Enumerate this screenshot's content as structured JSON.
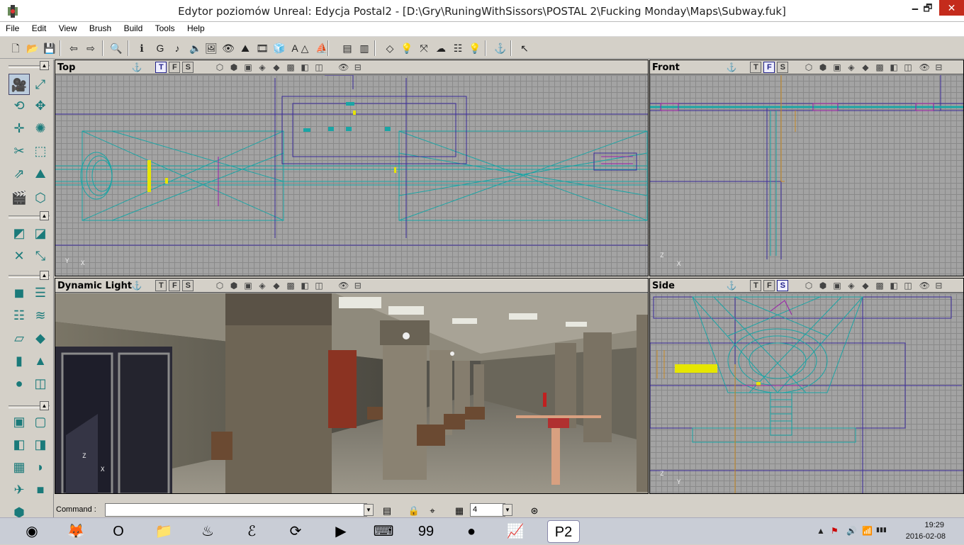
{
  "window": {
    "title": "Edytor poziomów Unreal: Edycja Postal2 - [D:\\Gry\\RuningWithSissors\\POSTAL 2\\Fucking Monday\\Maps\\Subway.fuk]",
    "minimize": "🗕",
    "maximize": "🗗",
    "close": "✕"
  },
  "menu": [
    "File",
    "Edit",
    "View",
    "Brush",
    "Build",
    "Tools",
    "Help"
  ],
  "toolbar_icons": [
    "new-file-icon",
    "open-folder-icon",
    "save-icon",
    "undo-icon",
    "redo-icon",
    "find-actor-icon",
    "actor-properties-icon",
    "group-browser-icon",
    "music-browser-icon",
    "sound-browser-icon",
    "texture-browser-icon",
    "mesh-browser-icon",
    "static-mesh-browser-icon",
    "animation-browser-icon",
    "prefab-browser-icon",
    "font-browser-icon",
    "geometry-rebuild-icon",
    "terrain-icon",
    "2d-shape-editor-icon",
    "surface-properties-icon",
    "build-geometry-icon",
    "build-lighting-icon",
    "build-paths-icon",
    "build-options-icon",
    "build-all-icon",
    "actor-class-icon",
    "play-level-icon",
    "context-help-icon"
  ],
  "toolbar_glyphs": [
    "🗋",
    "📂",
    "💾",
    "⇦",
    "⇨",
    "🔍",
    "ℹ",
    "G",
    "♪",
    "🔈",
    "🖼",
    "👁",
    "⛰",
    "🎞",
    "🧊",
    "A",
    "△",
    "⛵",
    "▤",
    "▥",
    "◇",
    "💡",
    "⤧",
    "☁",
    "☷",
    "💡",
    "⚓",
    "↖"
  ],
  "viewports": {
    "top": {
      "title": "Top",
      "axis_y": "Y",
      "axis_x": "X",
      "modes": [
        "T",
        "F",
        "S"
      ],
      "active": "T"
    },
    "front": {
      "title": "Front",
      "axis_y": "Z",
      "axis_x": "X",
      "modes": [
        "T",
        "F",
        "S"
      ],
      "active": "F"
    },
    "persp": {
      "title": "Dynamic Light",
      "axis_y": "Z",
      "axis_x": "X",
      "modes": [
        "T",
        "F",
        "S"
      ],
      "active": ""
    },
    "side": {
      "title": "Side",
      "axis_y": "Z",
      "axis_x": "Y",
      "modes": [
        "T",
        "F",
        "S"
      ],
      "active": "S"
    }
  },
  "command": {
    "label": "Command :",
    "value": "",
    "grid_size": "4"
  },
  "taskbar_apps": [
    "Google Chrome",
    "Firefox",
    "Opera",
    "File Explorer",
    "Steam",
    "Unknown App",
    "Media App",
    "Windows Media Player",
    "Keyboard App",
    "Performance Monitor",
    "Recorder",
    "Network Monitor",
    "POSTAL 2 Editor"
  ],
  "taskbar_glyphs": [
    "◉",
    "🦊",
    "O",
    "📁",
    "♨",
    "ℰ",
    "⟳",
    "▶",
    "⌨",
    "99",
    "●",
    "📈",
    "P2"
  ],
  "clock": {
    "time": "19:29",
    "date": "2016-02-08"
  },
  "tray": [
    "▲",
    "⚑",
    "🔊",
    "📶",
    "▮▮▮"
  ],
  "colors": {
    "teal": "#1aa5a5",
    "purple": "#3a2a9a",
    "magenta": "#9a1aaa",
    "yellow": "#e6e600",
    "grid_bg": "#a3a3a3"
  }
}
